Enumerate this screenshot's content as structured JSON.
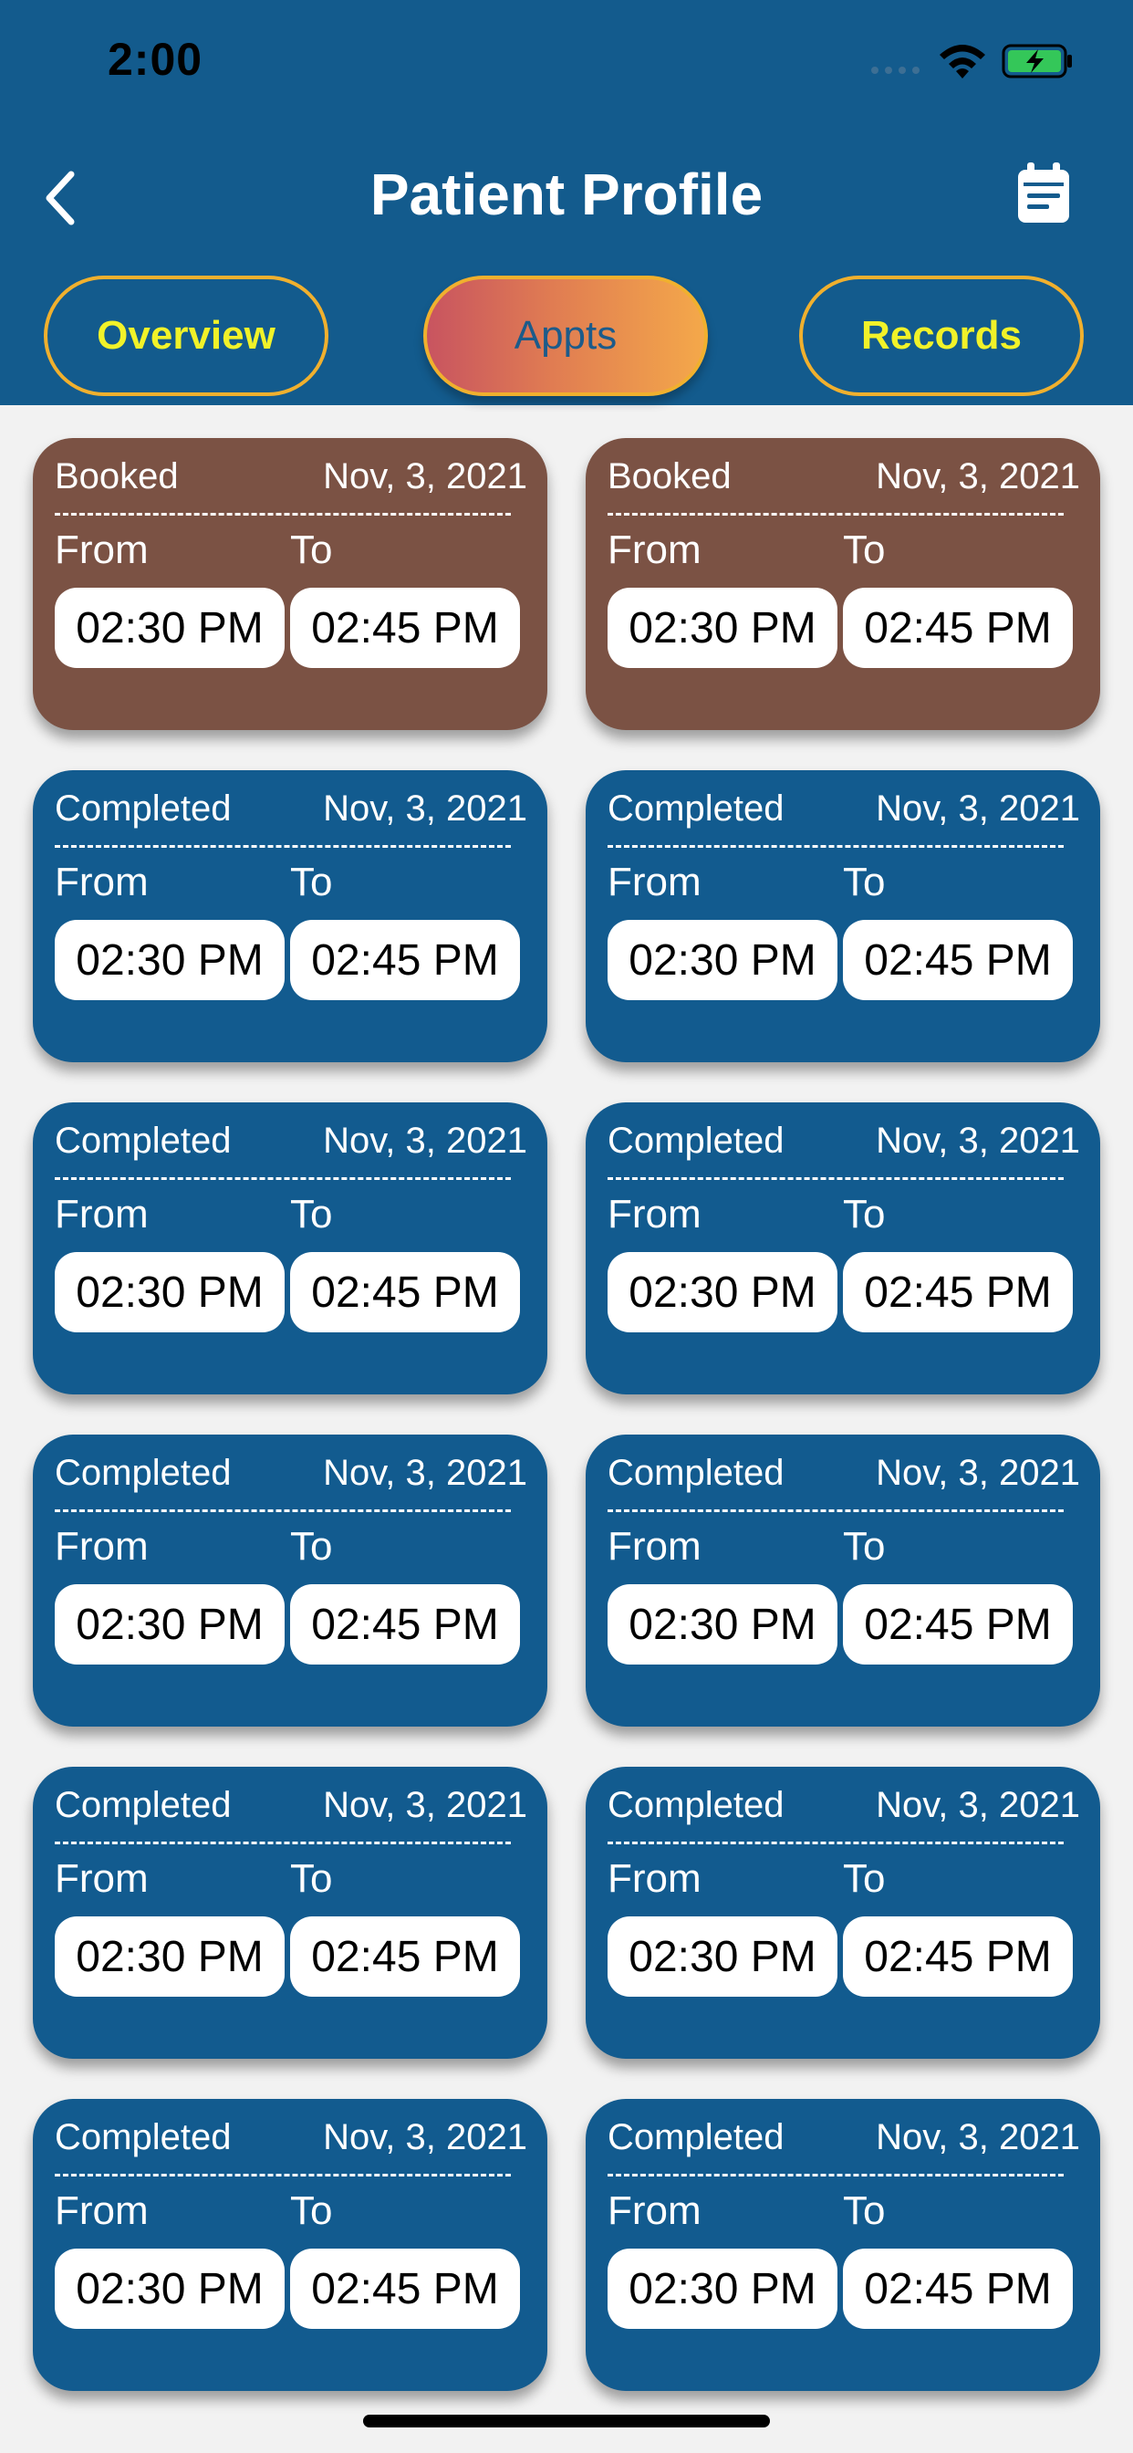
{
  "status_bar": {
    "time": "2:00"
  },
  "header": {
    "title": "Patient Profile",
    "back_icon": "chevron-left-icon",
    "calendar_icon": "calendar-icon"
  },
  "tabs": [
    {
      "label": "Overview",
      "active": false
    },
    {
      "label": "Appts",
      "active": true
    },
    {
      "label": "Records",
      "active": false
    }
  ],
  "colors": {
    "header_bg": "#135b8d",
    "booked_card": "#7b5244",
    "completed_card": "#125b8f",
    "tab_border": "#f0b02e",
    "tab_text": "#f1f229"
  },
  "appointments": [
    {
      "status": "Booked",
      "date": "Nov, 3, 2021",
      "from_label": "From",
      "to_label": "To",
      "from": "02:30 PM",
      "to": "02:45 PM"
    },
    {
      "status": "Booked",
      "date": "Nov, 3, 2021",
      "from_label": "From",
      "to_label": "To",
      "from": "02:30 PM",
      "to": "02:45 PM"
    },
    {
      "status": "Completed",
      "date": "Nov, 3, 2021",
      "from_label": "From",
      "to_label": "To",
      "from": "02:30 PM",
      "to": "02:45 PM"
    },
    {
      "status": "Completed",
      "date": "Nov, 3, 2021",
      "from_label": "From",
      "to_label": "To",
      "from": "02:30 PM",
      "to": "02:45 PM"
    },
    {
      "status": "Completed",
      "date": "Nov, 3, 2021",
      "from_label": "From",
      "to_label": "To",
      "from": "02:30 PM",
      "to": "02:45 PM"
    },
    {
      "status": "Completed",
      "date": "Nov, 3, 2021",
      "from_label": "From",
      "to_label": "To",
      "from": "02:30 PM",
      "to": "02:45 PM"
    },
    {
      "status": "Completed",
      "date": "Nov, 3, 2021",
      "from_label": "From",
      "to_label": "To",
      "from": "02:30 PM",
      "to": "02:45 PM"
    },
    {
      "status": "Completed",
      "date": "Nov, 3, 2021",
      "from_label": "From",
      "to_label": "To",
      "from": "02:30 PM",
      "to": "02:45 PM"
    },
    {
      "status": "Completed",
      "date": "Nov, 3, 2021",
      "from_label": "From",
      "to_label": "To",
      "from": "02:30 PM",
      "to": "02:45 PM"
    },
    {
      "status": "Completed",
      "date": "Nov, 3, 2021",
      "from_label": "From",
      "to_label": "To",
      "from": "02:30 PM",
      "to": "02:45 PM"
    },
    {
      "status": "Completed",
      "date": "Nov, 3, 2021",
      "from_label": "From",
      "to_label": "To",
      "from": "02:30 PM",
      "to": "02:45 PM"
    },
    {
      "status": "Completed",
      "date": "Nov, 3, 2021",
      "from_label": "From",
      "to_label": "To",
      "from": "02:30 PM",
      "to": "02:45 PM"
    }
  ]
}
